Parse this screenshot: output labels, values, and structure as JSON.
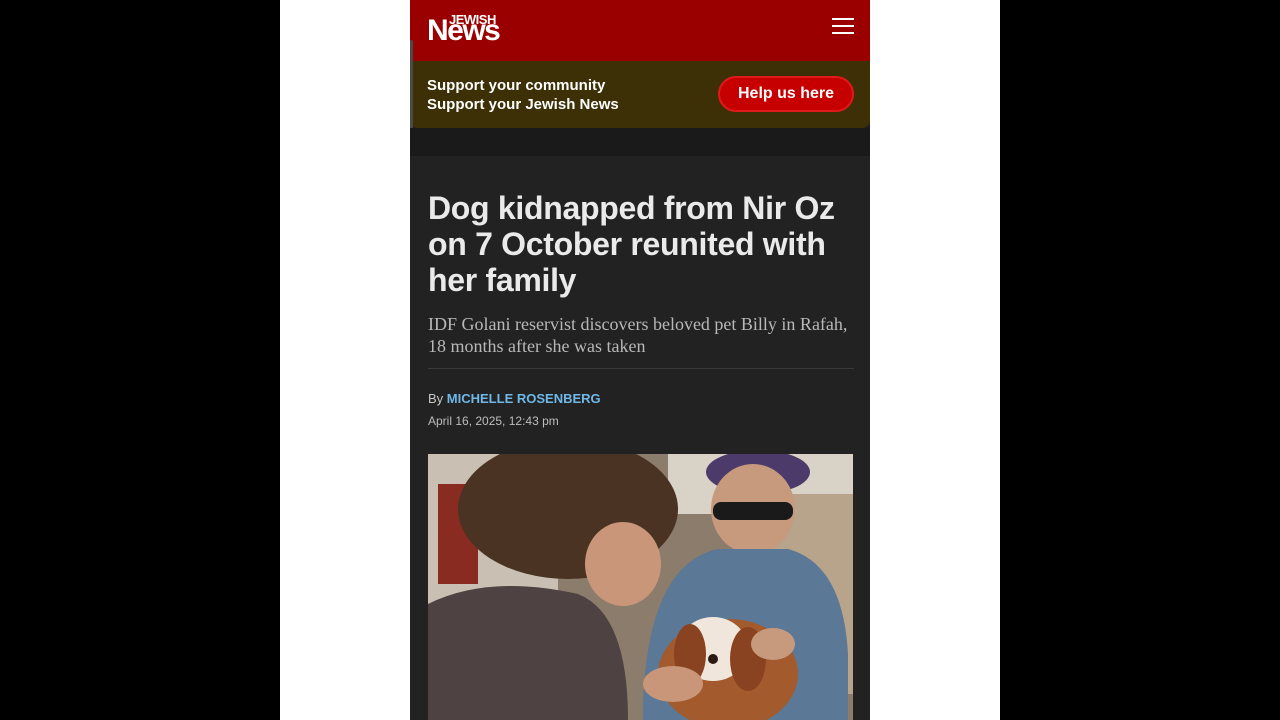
{
  "header": {
    "logo_small": "JEWISH",
    "logo_large": "News",
    "menu_icon": "hamburger-menu-icon",
    "bg_color": "#9b0000"
  },
  "banner": {
    "line1": "Support your community",
    "line2": "Support your Jewish News",
    "button_label": "Help us here",
    "button_color": "#c60000",
    "bg_color": "#3d2f06"
  },
  "article": {
    "headline": "Dog kidnapped from Nir Oz on 7 October reunited with her family",
    "subheadline": "IDF Golani reservist discovers beloved pet Billy in Rafah, 18 months after she was taken",
    "by_label": "By",
    "author": "MICHELLE ROSENBERG",
    "date": "April 16, 2025, 12:43 pm",
    "author_color": "#6fb8e8"
  }
}
